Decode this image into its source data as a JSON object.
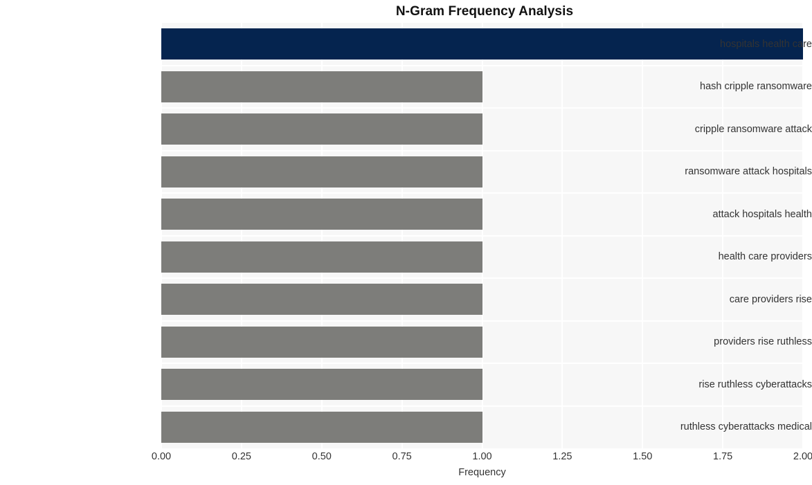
{
  "chart_data": {
    "type": "bar",
    "orientation": "horizontal",
    "title": "N-Gram Frequency Analysis",
    "xlabel": "Frequency",
    "ylabel": "",
    "categories": [
      "hospitals health care",
      "hash cripple ransomware",
      "cripple ransomware attack",
      "ransomware attack hospitals",
      "attack hospitals health",
      "health care providers",
      "care providers rise",
      "providers rise ruthless",
      "rise ruthless cyberattacks",
      "ruthless cyberattacks medical"
    ],
    "values": [
      2,
      1,
      1,
      1,
      1,
      1,
      1,
      1,
      1,
      1
    ],
    "bar_colors": [
      "#05244f",
      "#7d7d7a",
      "#7d7d7a",
      "#7d7d7a",
      "#7d7d7a",
      "#7d7d7a",
      "#7d7d7a",
      "#7d7d7a",
      "#7d7d7a",
      "#7d7d7a"
    ],
    "xlim": [
      0.0,
      2.0
    ],
    "xticks": [
      0.0,
      0.25,
      0.5,
      0.75,
      1.0,
      1.25,
      1.5,
      1.75,
      2.0
    ],
    "xticklabels": [
      "0.00",
      "0.25",
      "0.50",
      "0.75",
      "1.00",
      "1.25",
      "1.50",
      "1.75",
      "2.00"
    ],
    "grid": true,
    "grid_color": "#ffffff",
    "plot_background": "#f7f7f7",
    "figure_background": "#ffffff",
    "legend": null,
    "highlight_color": "#05244f",
    "default_color": "#7d7d7a"
  }
}
